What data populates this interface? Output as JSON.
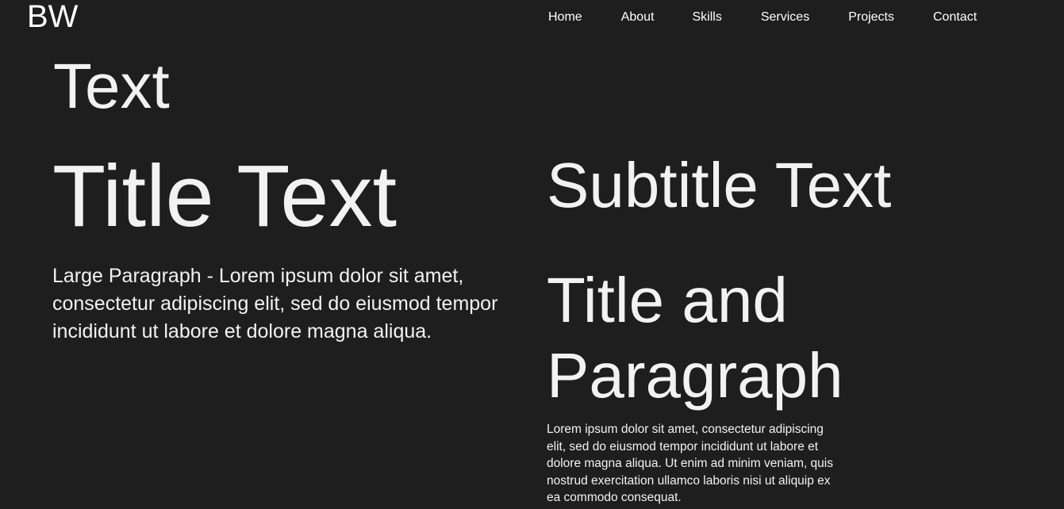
{
  "header": {
    "logo": "BW",
    "nav": {
      "home": "Home",
      "about": "About",
      "skills": "Skills",
      "services": "Services",
      "projects": "Projects",
      "contact": "Contact"
    }
  },
  "left": {
    "heading": "Text",
    "title": "Title Text",
    "large_paragraph": "Large Paragraph - Lorem ipsum dolor sit amet, consectetur adipiscing elit, sed do eiusmod tempor incididunt ut labore et dolore magna aliqua."
  },
  "right": {
    "subtitle": "Subtitle Text",
    "title_and_paragraph": "Title and Paragraph",
    "paragraph": "Lorem ipsum dolor sit amet, consectetur adipiscing elit, sed do eiusmod tempor incididunt ut labore et dolore magna aliqua. Ut enim ad minim veniam, quis nostrud exercitation ullamco laboris nisi ut aliquip ex ea commodo consequat."
  },
  "colors": {
    "background": "#1e1e1e",
    "text": "#f2f2f2"
  }
}
